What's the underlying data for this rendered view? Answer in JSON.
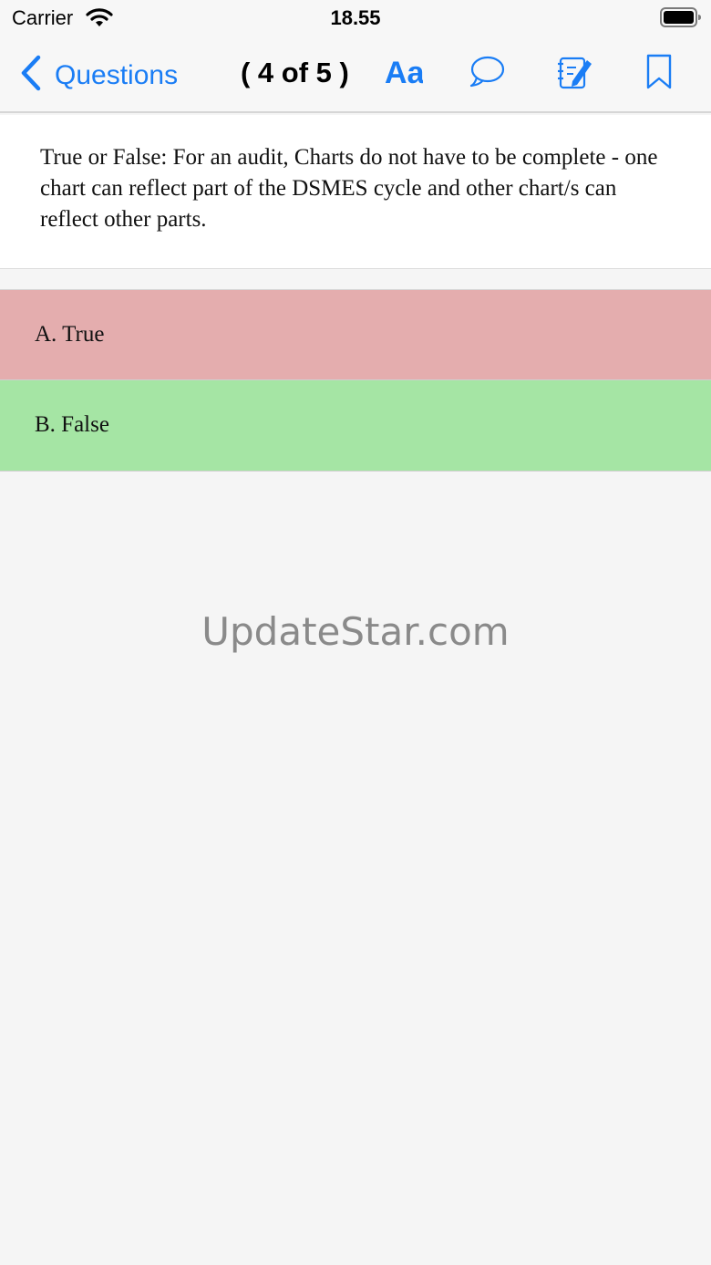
{
  "status_bar": {
    "carrier": "Carrier",
    "time": "18.55",
    "icons": [
      "wifi-icon",
      "battery-icon"
    ]
  },
  "nav": {
    "back_label": "Questions",
    "counter": "( 4 of 5 )",
    "font_label": "Aa",
    "icons": [
      "chevron-left-icon",
      "speech-bubble-icon",
      "notepad-pencil-icon",
      "bookmark-icon"
    ],
    "accent_color": "#1a7df5"
  },
  "question": {
    "text": "True or False: For an audit, Charts do not have to be complete - one chart can reflect part of the DSMES cycle and other chart/s can reflect other parts."
  },
  "options": [
    {
      "label": "A. True",
      "state": "incorrect",
      "color": "#e4adae"
    },
    {
      "label": "B. False",
      "state": "correct",
      "color": "#a5e5a4"
    }
  ],
  "watermark": "UpdateStar.com"
}
